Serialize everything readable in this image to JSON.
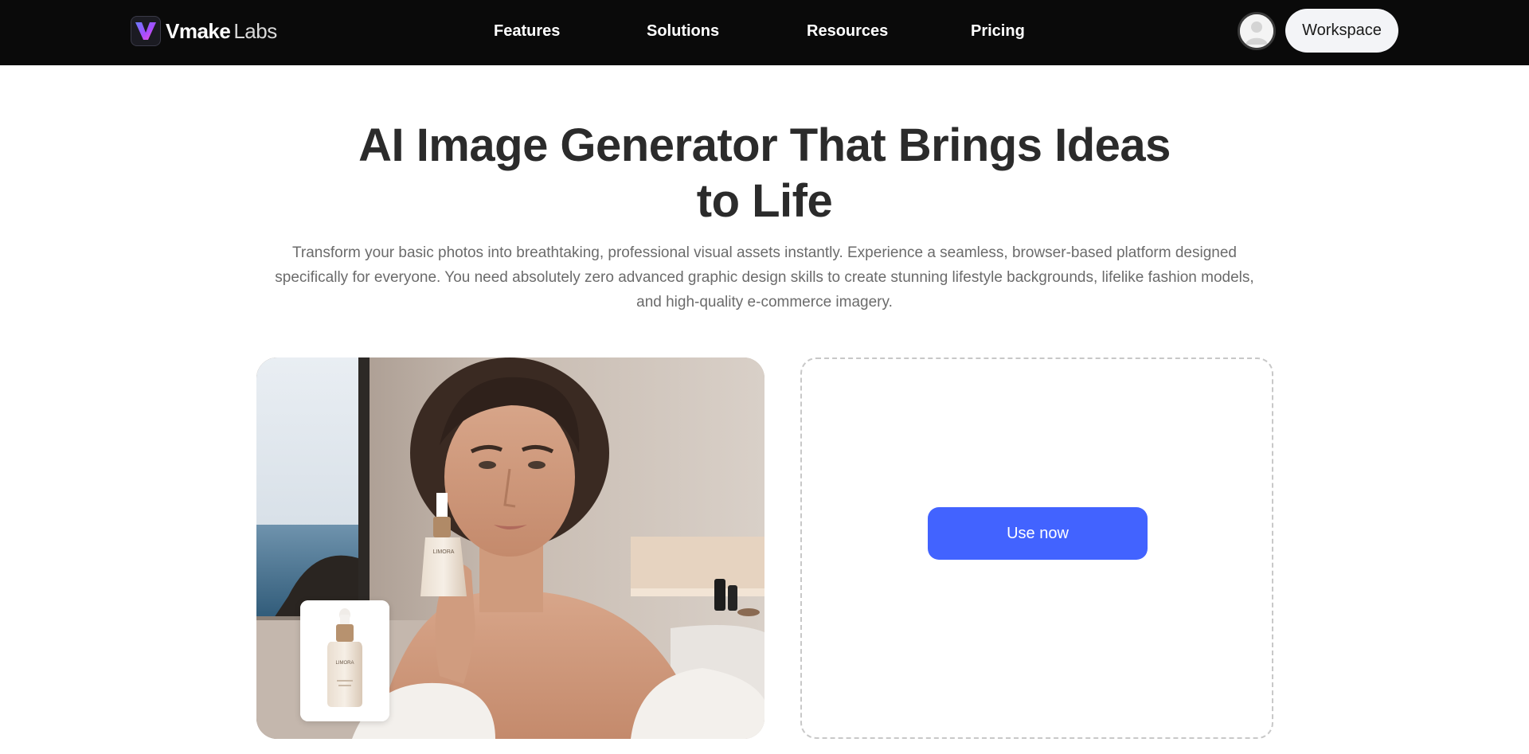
{
  "header": {
    "brand": {
      "name": "Vmake",
      "suffix": "Labs"
    },
    "nav": [
      {
        "label": "Features"
      },
      {
        "label": "Solutions"
      },
      {
        "label": "Resources"
      },
      {
        "label": "Pricing"
      }
    ],
    "avatar_icon": "user-avatar-icon",
    "workspace_label": "Workspace"
  },
  "hero": {
    "title_line1": "AI Image Generator That Brings Ideas",
    "title_line2": "to Life",
    "description_line1": "Transform your basic photos into breathtaking, professional visual assets instantly. Experience a seamless, browser-based platform designed",
    "description_line2": "specifically for everyone. You need absolutely zero advanced graphic design skills to create stunning lifestyle backgrounds, lifelike fashion models,",
    "description_line3": "and high-quality e-commerce imagery."
  },
  "showcase": {
    "product_label": "LIMORA"
  },
  "upload": {
    "cta_label": "Use now"
  },
  "colors": {
    "header_bg": "#0a0a0a",
    "accent": "#4263ff",
    "title": "#2b2b2b",
    "body_text": "#6b6b6b"
  }
}
